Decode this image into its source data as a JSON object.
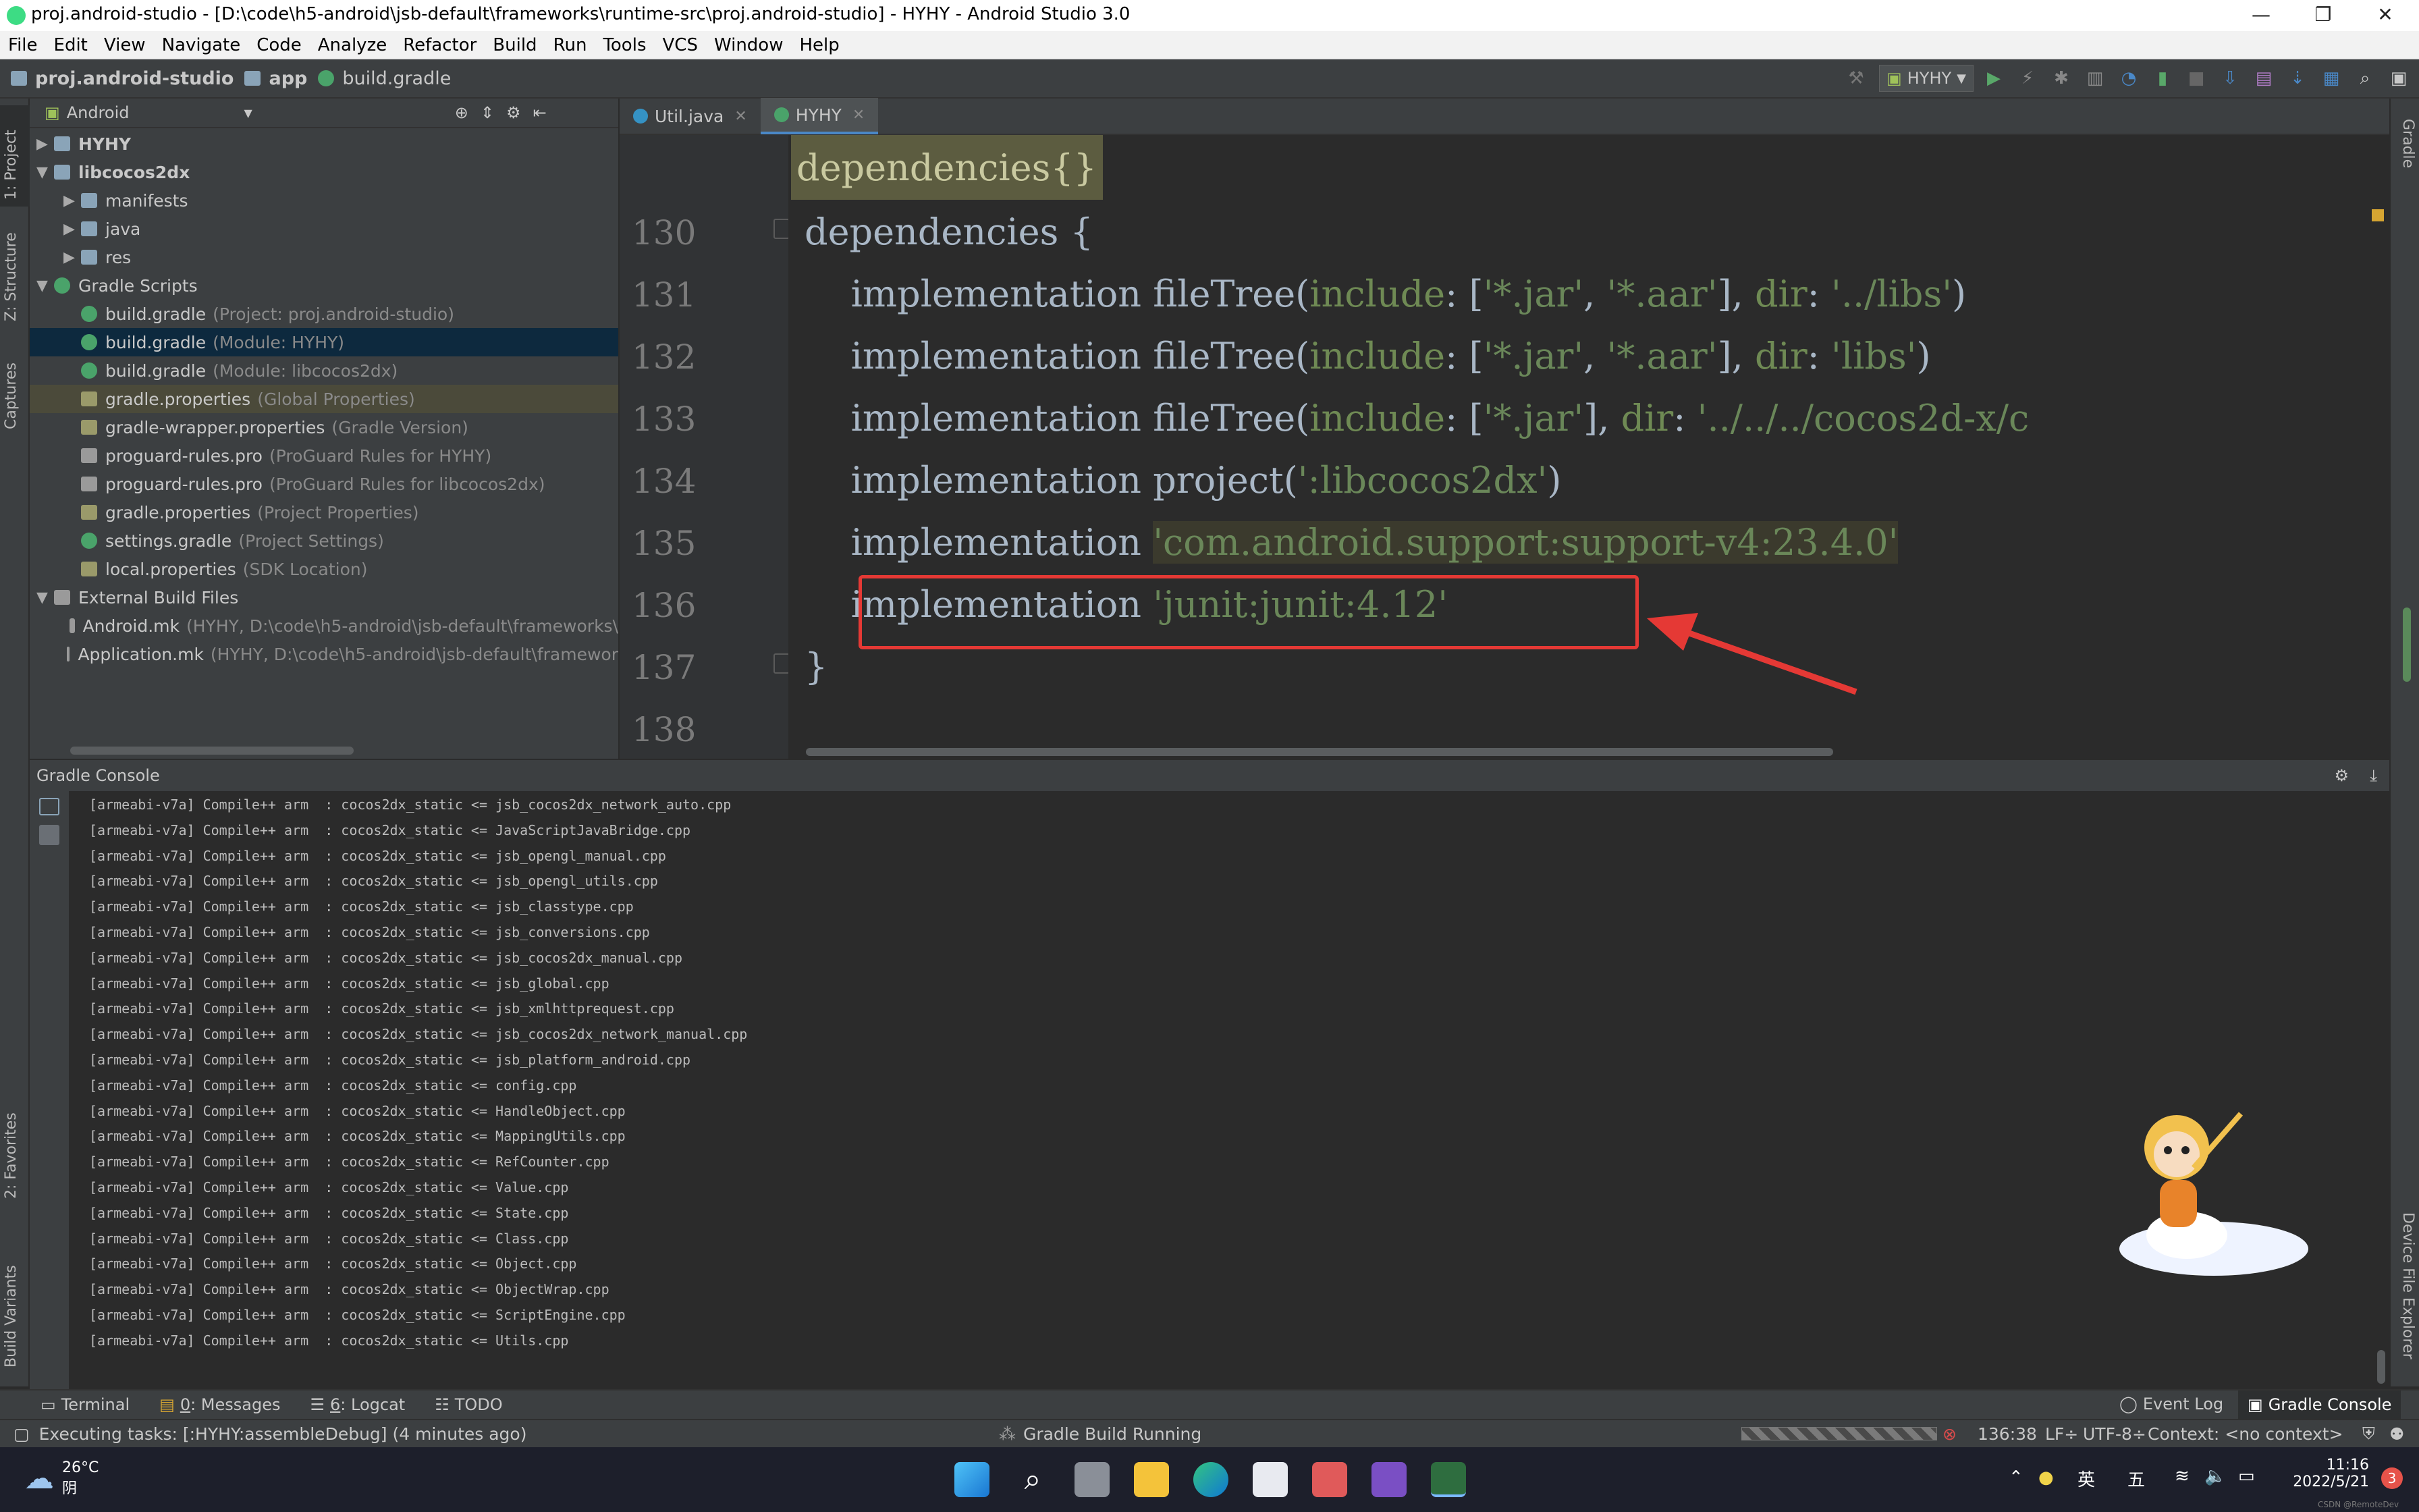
{
  "window": {
    "title": "proj.android-studio - [D:\\code\\h5-android\\jsb-default\\frameworks\\runtime-src\\proj.android-studio] - HYHY - Android Studio 3.0",
    "minimize": "—",
    "maximize": "❐",
    "close": "✕"
  },
  "menu": [
    "File",
    "Edit",
    "View",
    "Navigate",
    "Code",
    "Analyze",
    "Refactor",
    "Build",
    "Run",
    "Tools",
    "VCS",
    "Window",
    "Help"
  ],
  "breadcrumb": {
    "project": "proj.android-studio",
    "module": "app",
    "file": "build.gradle"
  },
  "toolbar": {
    "run_config": "HYHY"
  },
  "left_stripe": {
    "project": "1: Project",
    "structure": "Z: Structure",
    "captures": "Captures",
    "favorites": "2: Favorites",
    "build_variants": "Build Variants"
  },
  "right_stripe": {
    "gradle": "Gradle",
    "device_explorer": "Device File Explorer"
  },
  "project_panel": {
    "view_selector": "Android",
    "tree": [
      {
        "label": "HYHY",
        "hint": "",
        "indent": 0,
        "kind": "module",
        "expanded": false,
        "bold": true
      },
      {
        "label": "libcocos2dx",
        "hint": "",
        "indent": 0,
        "kind": "module",
        "expanded": true,
        "bold": true
      },
      {
        "label": "manifests",
        "hint": "",
        "indent": 1,
        "kind": "folder",
        "expanded": false
      },
      {
        "label": "java",
        "hint": "",
        "indent": 1,
        "kind": "folder",
        "expanded": false
      },
      {
        "label": "res",
        "hint": "",
        "indent": 1,
        "kind": "folder",
        "expanded": false
      },
      {
        "label": "Gradle Scripts",
        "hint": "",
        "indent": 0,
        "kind": "gradle",
        "expanded": true
      },
      {
        "label": "build.gradle",
        "hint": "(Project: proj.android-studio)",
        "indent": 1,
        "kind": "gradle"
      },
      {
        "label": "build.gradle",
        "hint": "(Module: HYHY)",
        "indent": 1,
        "kind": "gradle",
        "selected": true
      },
      {
        "label": "build.gradle",
        "hint": "(Module: libcocos2dx)",
        "indent": 1,
        "kind": "gradle"
      },
      {
        "label": "gradle.properties",
        "hint": "(Global Properties)",
        "indent": 1,
        "kind": "prop",
        "highlight": true
      },
      {
        "label": "gradle-wrapper.properties",
        "hint": "(Gradle Version)",
        "indent": 1,
        "kind": "prop"
      },
      {
        "label": "proguard-rules.pro",
        "hint": "(ProGuard Rules for HYHY)",
        "indent": 1,
        "kind": "file"
      },
      {
        "label": "proguard-rules.pro",
        "hint": "(ProGuard Rules for libcocos2dx)",
        "indent": 1,
        "kind": "file"
      },
      {
        "label": "gradle.properties",
        "hint": "(Project Properties)",
        "indent": 1,
        "kind": "prop"
      },
      {
        "label": "settings.gradle",
        "hint": "(Project Settings)",
        "indent": 1,
        "kind": "gradle"
      },
      {
        "label": "local.properties",
        "hint": "(SDK Location)",
        "indent": 1,
        "kind": "prop"
      },
      {
        "label": "External Build Files",
        "hint": "",
        "indent": 0,
        "kind": "ext",
        "expanded": true
      },
      {
        "label": "Android.mk",
        "hint": "(HYHY, D:\\code\\h5-android\\jsb-default\\frameworks\\",
        "indent": 1,
        "kind": "file"
      },
      {
        "label": "Application.mk",
        "hint": "(HYHY, D:\\code\\h5-android\\jsb-default\\framewor",
        "indent": 1,
        "kind": "file"
      }
    ]
  },
  "editor": {
    "tabs": [
      {
        "label": "Util.java",
        "active": false
      },
      {
        "label": "HYHY",
        "active": true
      }
    ],
    "sticky_header": "dependencies{}",
    "lines": [
      {
        "num": "130",
        "parts": [
          {
            "t": "dependencies {",
            "c": "kw"
          }
        ]
      },
      {
        "num": "131",
        "parts": [
          {
            "t": "    implementation fileTree(",
            "c": "kw"
          },
          {
            "t": "include",
            "c": "param"
          },
          {
            "t": ": [",
            "c": "kw"
          },
          {
            "t": "'*.jar'",
            "c": "str"
          },
          {
            "t": ", ",
            "c": "kw"
          },
          {
            "t": "'*.aar'",
            "c": "str"
          },
          {
            "t": "], ",
            "c": "kw"
          },
          {
            "t": "dir",
            "c": "param"
          },
          {
            "t": ": ",
            "c": "kw"
          },
          {
            "t": "'../libs'",
            "c": "str"
          },
          {
            "t": ")",
            "c": "kw"
          }
        ]
      },
      {
        "num": "132",
        "parts": [
          {
            "t": "    implementation fileTree(",
            "c": "kw"
          },
          {
            "t": "include",
            "c": "param"
          },
          {
            "t": ": [",
            "c": "kw"
          },
          {
            "t": "'*.jar'",
            "c": "str"
          },
          {
            "t": ", ",
            "c": "kw"
          },
          {
            "t": "'*.aar'",
            "c": "str"
          },
          {
            "t": "], ",
            "c": "kw"
          },
          {
            "t": "dir",
            "c": "param"
          },
          {
            "t": ": ",
            "c": "kw"
          },
          {
            "t": "'libs'",
            "c": "str"
          },
          {
            "t": ")",
            "c": "kw"
          }
        ]
      },
      {
        "num": "133",
        "parts": [
          {
            "t": "    implementation fileTree(",
            "c": "kw"
          },
          {
            "t": "include",
            "c": "param"
          },
          {
            "t": ": [",
            "c": "kw"
          },
          {
            "t": "'*.jar'",
            "c": "str"
          },
          {
            "t": "], ",
            "c": "kw"
          },
          {
            "t": "dir",
            "c": "param"
          },
          {
            "t": ": ",
            "c": "kw"
          },
          {
            "t": "'../../../cocos2d-x/c",
            "c": "str"
          }
        ]
      },
      {
        "num": "134",
        "parts": [
          {
            "t": "    implementation project(",
            "c": "kw"
          },
          {
            "t": "':libcocos2dx'",
            "c": "str"
          },
          {
            "t": ")",
            "c": "kw"
          }
        ]
      },
      {
        "num": "135",
        "parts": [
          {
            "t": "    implementation ",
            "c": "kw"
          },
          {
            "t": "'com.android.support:support-v4:23.4.0'",
            "c": "hl"
          }
        ]
      },
      {
        "num": "136",
        "parts": [
          {
            "t": "    implementation ",
            "c": "kw"
          },
          {
            "t": "'junit:junit:4.12'",
            "c": "str"
          }
        ]
      },
      {
        "num": "137",
        "parts": [
          {
            "t": "}",
            "c": "kw"
          }
        ]
      },
      {
        "num": "138",
        "parts": []
      }
    ]
  },
  "console": {
    "title": "Gradle Console",
    "lines": [
      "[armeabi-v7a] Compile++ arm  : cocos2dx_static <= jsb_cocos2dx_network_auto.cpp",
      "[armeabi-v7a] Compile++ arm  : cocos2dx_static <= JavaScriptJavaBridge.cpp",
      "[armeabi-v7a] Compile++ arm  : cocos2dx_static <= jsb_opengl_manual.cpp",
      "[armeabi-v7a] Compile++ arm  : cocos2dx_static <= jsb_opengl_utils.cpp",
      "[armeabi-v7a] Compile++ arm  : cocos2dx_static <= jsb_classtype.cpp",
      "[armeabi-v7a] Compile++ arm  : cocos2dx_static <= jsb_conversions.cpp",
      "[armeabi-v7a] Compile++ arm  : cocos2dx_static <= jsb_cocos2dx_manual.cpp",
      "[armeabi-v7a] Compile++ arm  : cocos2dx_static <= jsb_global.cpp",
      "[armeabi-v7a] Compile++ arm  : cocos2dx_static <= jsb_xmlhttprequest.cpp",
      "[armeabi-v7a] Compile++ arm  : cocos2dx_static <= jsb_cocos2dx_network_manual.cpp",
      "[armeabi-v7a] Compile++ arm  : cocos2dx_static <= jsb_platform_android.cpp",
      "[armeabi-v7a] Compile++ arm  : cocos2dx_static <= config.cpp",
      "[armeabi-v7a] Compile++ arm  : cocos2dx_static <= HandleObject.cpp",
      "[armeabi-v7a] Compile++ arm  : cocos2dx_static <= MappingUtils.cpp",
      "[armeabi-v7a] Compile++ arm  : cocos2dx_static <= RefCounter.cpp",
      "[armeabi-v7a] Compile++ arm  : cocos2dx_static <= Value.cpp",
      "[armeabi-v7a] Compile++ arm  : cocos2dx_static <= State.cpp",
      "[armeabi-v7a] Compile++ arm  : cocos2dx_static <= Class.cpp",
      "[armeabi-v7a] Compile++ arm  : cocos2dx_static <= Object.cpp",
      "[armeabi-v7a] Compile++ arm  : cocos2dx_static <= ObjectWrap.cpp",
      "[armeabi-v7a] Compile++ arm  : cocos2dx_static <= ScriptEngine.cpp",
      "[armeabi-v7a] Compile++ arm  : cocos2dx_static <= Utils.cpp"
    ]
  },
  "tool_tabs": {
    "terminal": "Terminal",
    "messages_num": "0",
    "messages": ": Messages",
    "logcat_num": "6",
    "logcat": ": Logcat",
    "todo": "TODO",
    "event_log": "Event Log",
    "gradle_console": "Gradle Console"
  },
  "status": {
    "message": "Executing tasks: [:HYHY:assembleDebug] (4 minutes ago)",
    "build": "Gradle Build Running",
    "position": "136:38",
    "line_sep": "LF÷",
    "encoding": "UTF-8÷",
    "context": "Context: <no context>"
  },
  "taskbar": {
    "temp": "26°C",
    "weather": "阴",
    "ime_lang": "英",
    "ime_mode": "五",
    "time": "11:16",
    "date": "2022/5/21",
    "notif": "3"
  },
  "watermark": "CSDN @RemoteDev",
  "colors": {
    "accent": "#4a88c7",
    "annotation_red": "#e53935",
    "string": "#6a8759"
  }
}
